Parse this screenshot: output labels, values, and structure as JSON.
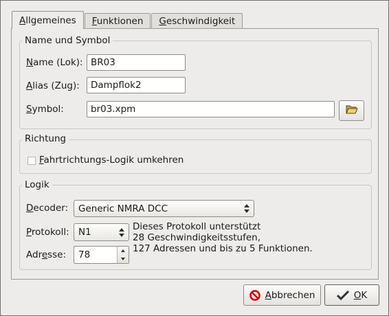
{
  "tabs": [
    {
      "label": "Allgemeines",
      "mnemonic": "A",
      "rest": "llgemeines"
    },
    {
      "label": "Funktionen",
      "mnemonic": "F",
      "rest": "unktionen"
    },
    {
      "label": "Geschwindigkeit",
      "mnemonic": "G",
      "rest": "eschwindigkeit"
    }
  ],
  "name_symbol": {
    "title": "Name und Symbol",
    "name_label": {
      "mnemonic": "N",
      "rest": "ame (Lok):"
    },
    "name_value": "BR03",
    "alias_label": {
      "mnemonic": "A",
      "rest": "lias (Zug):"
    },
    "alias_value": "Dampflok2",
    "symbol_label": {
      "mnemonic": "S",
      "rest": "ymbol:"
    },
    "symbol_value": "br03.xpm",
    "browse_icon": "folder-open-icon"
  },
  "direction": {
    "title": "Richtung",
    "reverse_label": {
      "mnemonic": "F",
      "rest": "ahrtrichtungs-Logik umkehren"
    },
    "reverse_checked": false
  },
  "logic": {
    "title": "Logik",
    "decoder_label": {
      "mnemonic": "D",
      "rest": "ecoder:"
    },
    "decoder_value": "Generic NMRA DCC",
    "protocol_label": {
      "mnemonic": "P",
      "rest": "rotokoll:"
    },
    "protocol_value": "N1",
    "address_label": {
      "before": "Adr",
      "mnemonic": "e",
      "rest": "sse:"
    },
    "address_value": "78",
    "info_lines": [
      "Dieses Protokoll unterstützt",
      "28 Geschwindigkeitsstufen,",
      "127 Adressen und bis zu 5 Funktionen."
    ]
  },
  "buttons": {
    "cancel": {
      "mnemonic": "A",
      "rest": "bbrechen",
      "icon": "cancel-icon",
      "color": "#cc0000"
    },
    "ok": {
      "mnemonic": "O",
      "rest": "K",
      "icon": "checkmark-icon"
    }
  }
}
